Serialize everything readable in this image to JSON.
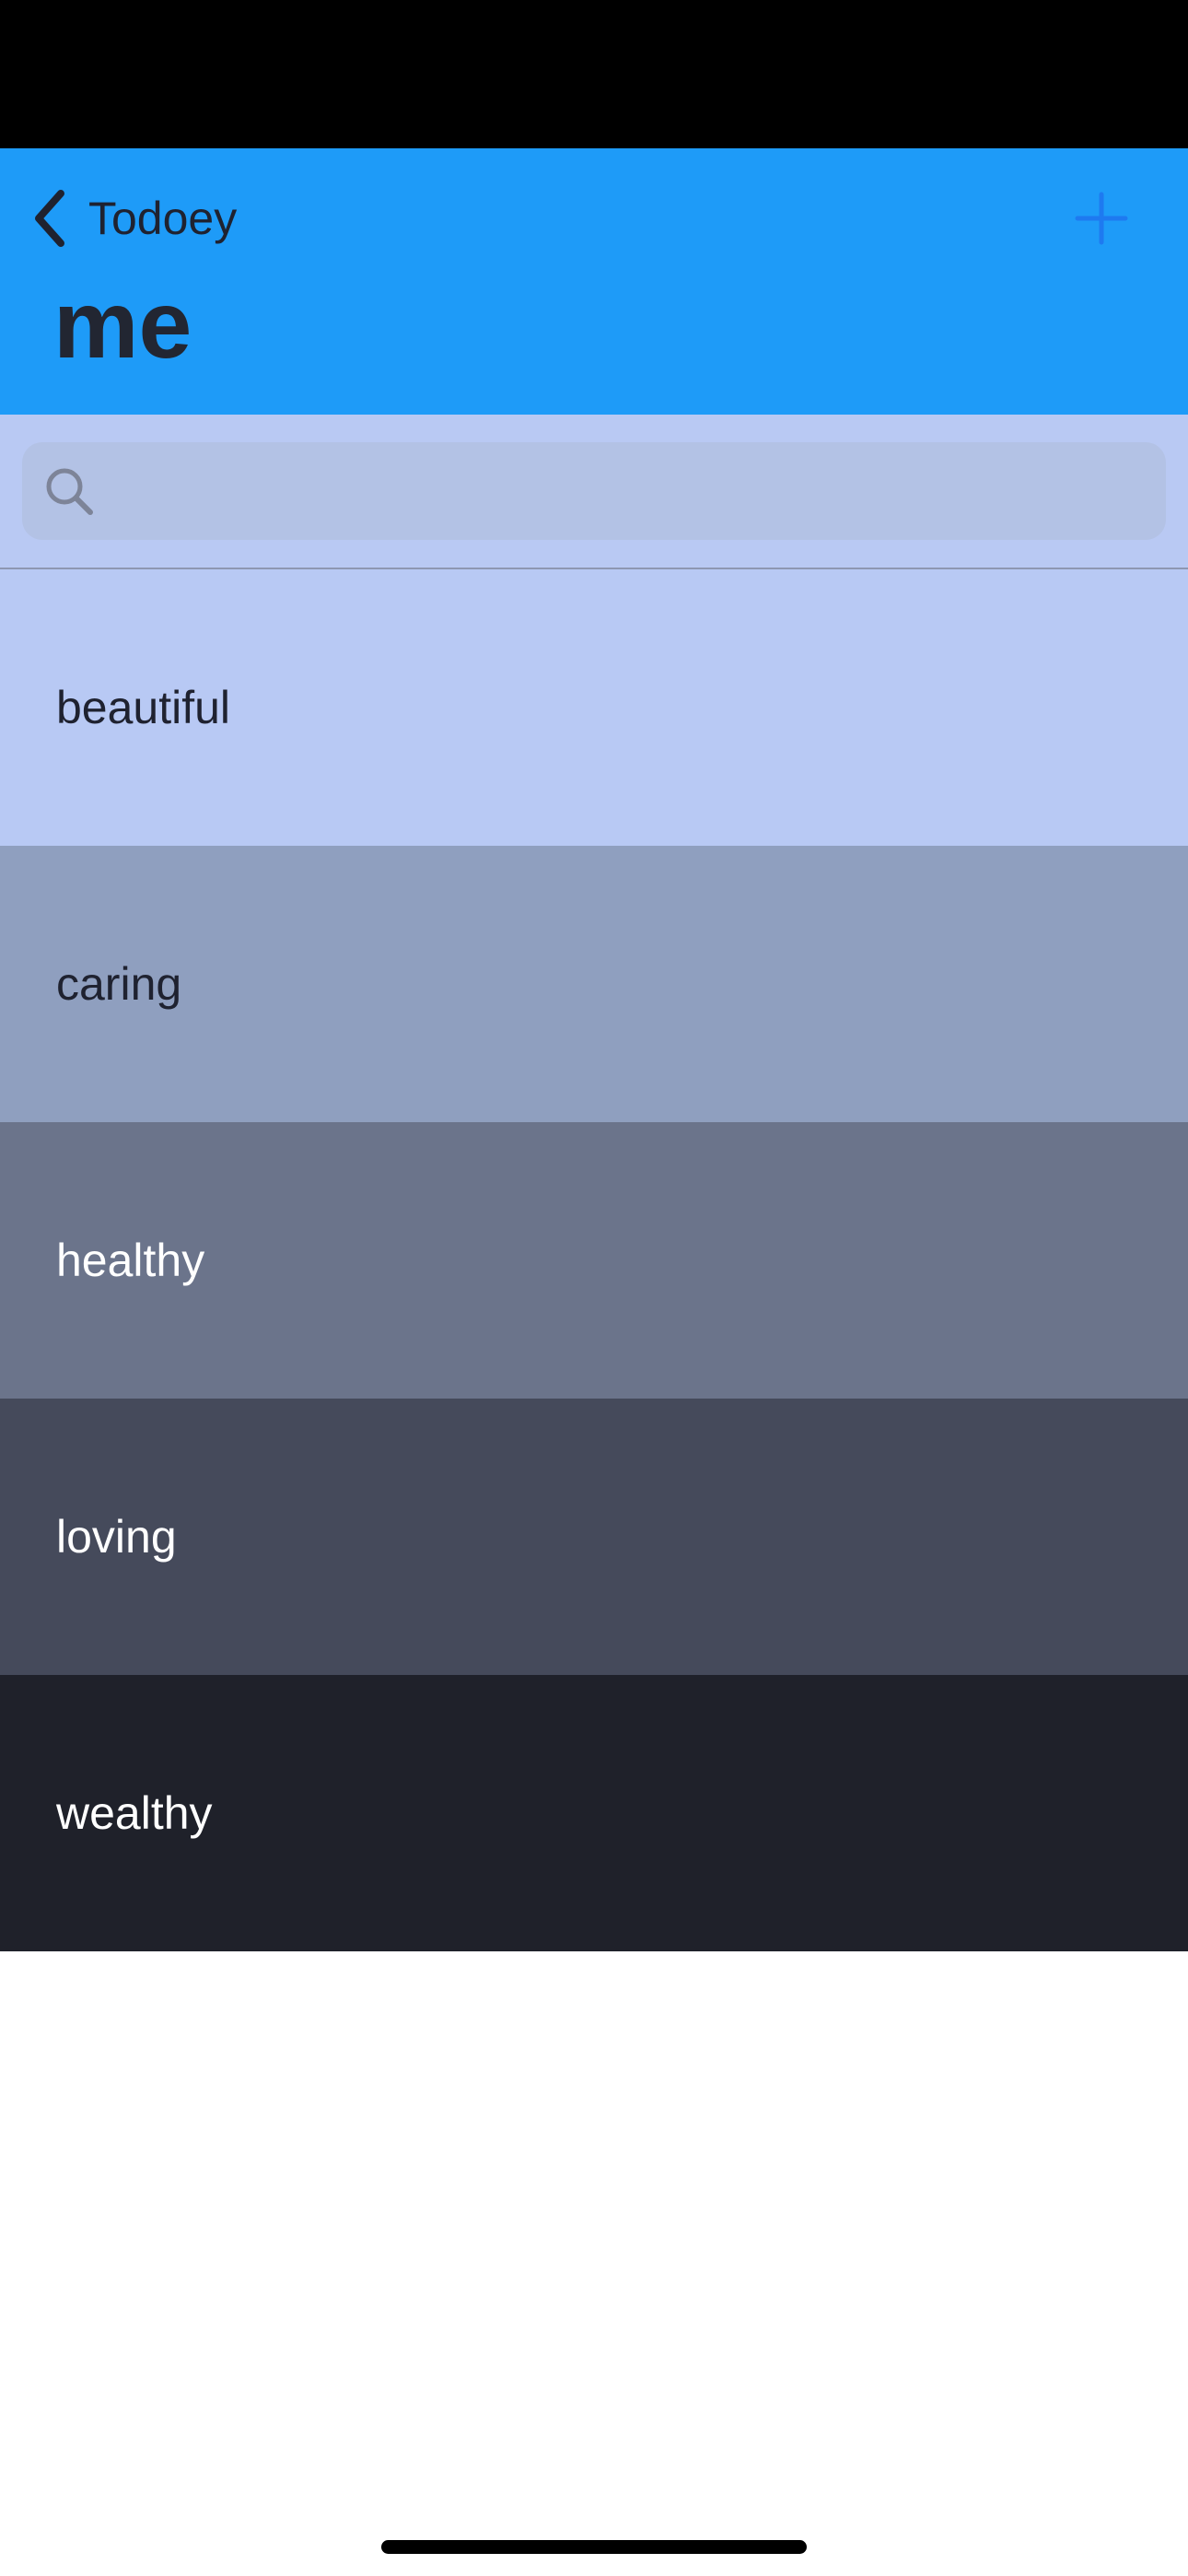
{
  "nav": {
    "back_label": "Todoey",
    "title": "me",
    "add_icon": "plus-icon",
    "back_icon": "chevron-left-icon"
  },
  "search": {
    "placeholder": "",
    "icon": "search-icon"
  },
  "items": [
    {
      "label": "beautiful",
      "background": "#b8c9f4",
      "text_color": "#1f2230"
    },
    {
      "label": "caring",
      "background": "#8f9fbf",
      "text_color": "#1f2230"
    },
    {
      "label": "healthy",
      "background": "#6b748b",
      "text_color": "#ffffff"
    },
    {
      "label": "loving",
      "background": "#454a5b",
      "text_color": "#ffffff"
    },
    {
      "label": "wealthy",
      "background": "#1f212a",
      "text_color": "#ffffff"
    }
  ],
  "colors": {
    "nav_background": "#1e9bf8",
    "accent": "#1e7af0",
    "search_background": "#b9c9f3"
  }
}
